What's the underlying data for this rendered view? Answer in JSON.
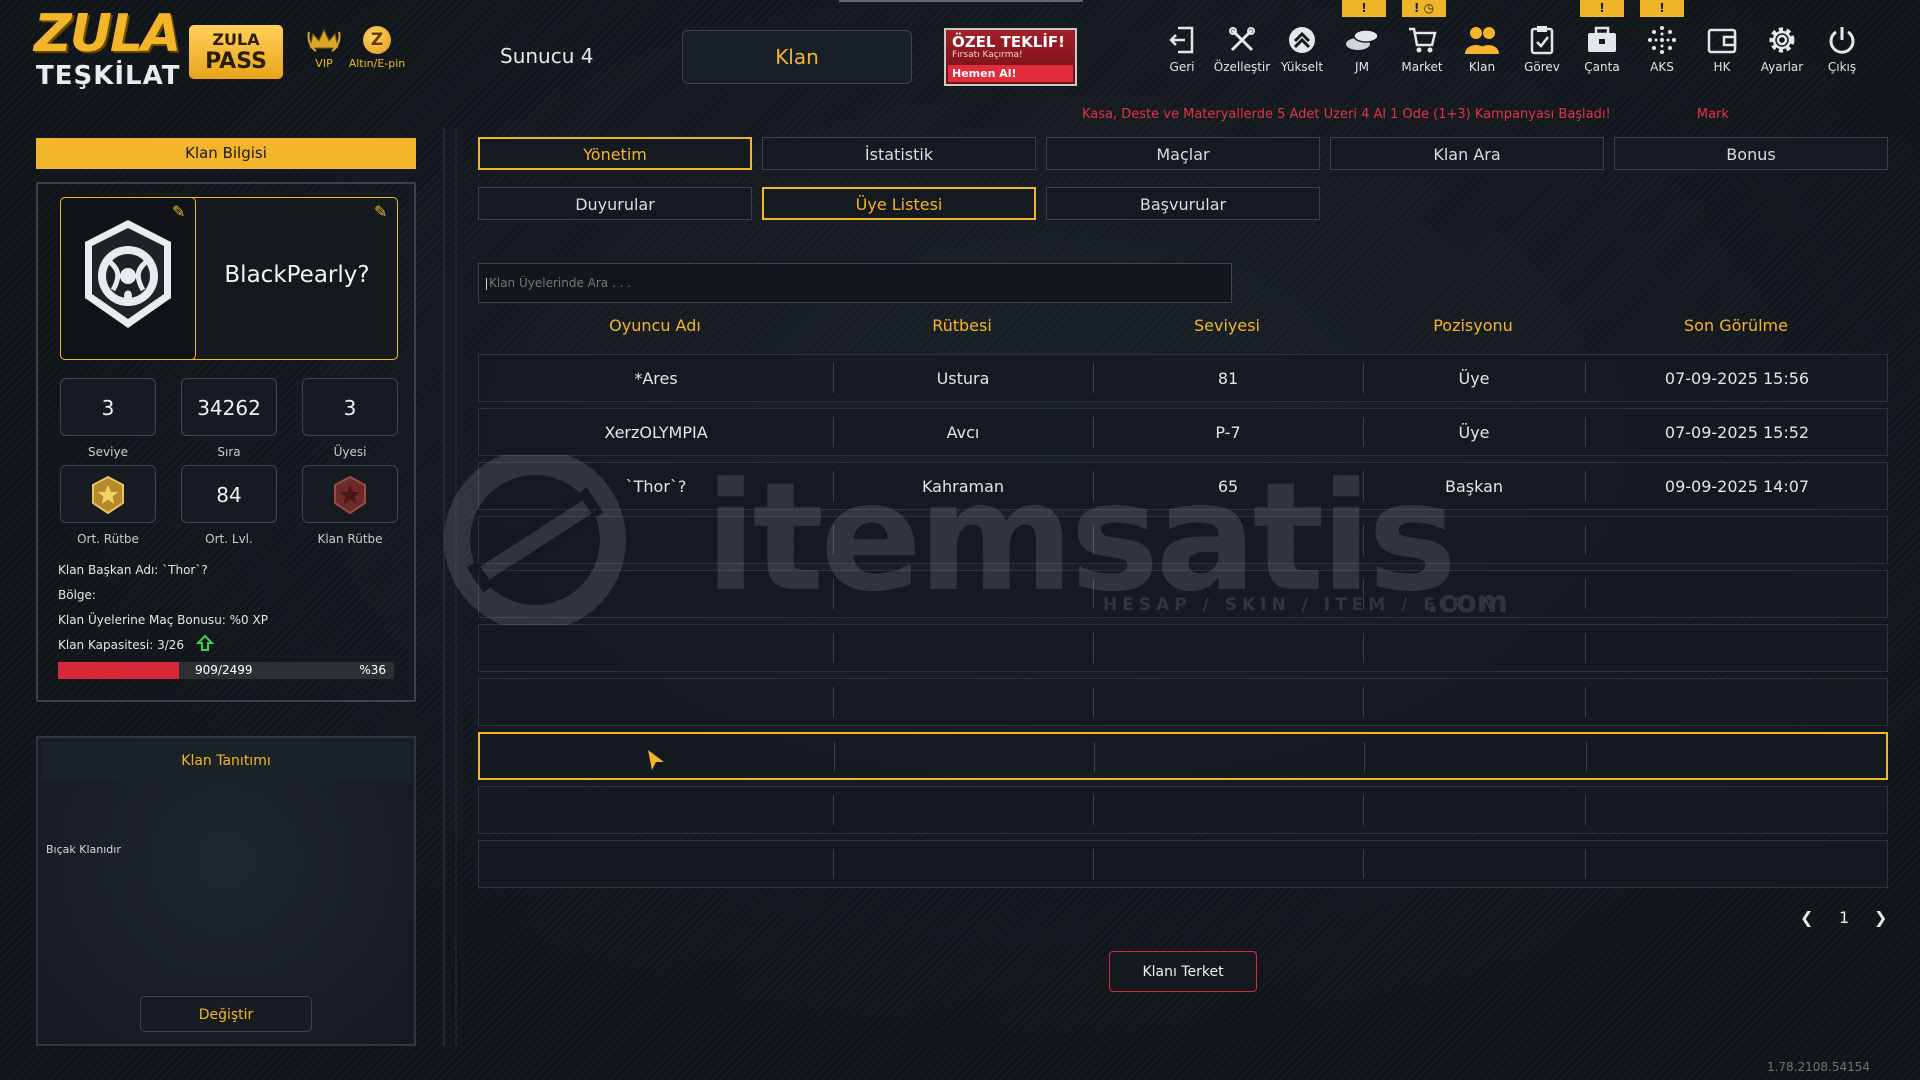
{
  "header": {
    "logo_top": "ZULA",
    "logo_bottom": "TEŞKİLAT",
    "pass_top": "ZULA",
    "pass_bottom": "PASS",
    "vip_label": "VIP",
    "gold_label": "Altın/E-pin",
    "server": "Sunucu 4",
    "section_button": "Klan",
    "offer_title": "ÖZEL TEKLİF!",
    "offer_sub": "Fırsatı Kaçırma!",
    "offer_cta": "Hemen Al!",
    "ticker": "Kasa, Deste ve Materyallerde 5 Adet Üzeri 4 Al 1 Öde (1+3) Kampanyası Başladı!",
    "ticker_next": "Mark"
  },
  "nav": [
    {
      "label": "Geri",
      "icon": "back-icon"
    },
    {
      "label": "Özelleştir",
      "icon": "customize-icon"
    },
    {
      "label": "Yükselt",
      "icon": "upgrade-icon"
    },
    {
      "label": "JM",
      "icon": "coins-icon"
    },
    {
      "label": "Market",
      "icon": "cart-icon"
    },
    {
      "label": "Klan",
      "icon": "clan-icon"
    },
    {
      "label": "Görev",
      "icon": "task-icon"
    },
    {
      "label": "Çanta",
      "icon": "bag-icon"
    },
    {
      "label": "AKS",
      "icon": "aks-icon"
    },
    {
      "label": "HK",
      "icon": "wallet-icon"
    },
    {
      "label": "Ayarlar",
      "icon": "gear-icon"
    },
    {
      "label": "Çıkış",
      "icon": "power-icon"
    }
  ],
  "clan": {
    "panel_title": "Klan Bilgisi",
    "name": "BlackPearly?",
    "stats": [
      {
        "value": "3",
        "label": "Seviye"
      },
      {
        "value": "34262",
        "label": "Sıra"
      },
      {
        "value": "3",
        "label": "Üyesi"
      }
    ],
    "badges": [
      {
        "label": "Ort. Rütbe"
      },
      {
        "value": "84",
        "label": "Ort. Lvl."
      },
      {
        "label": "Klan Rütbe"
      }
    ],
    "leader_line": "Klan Başkan Adı: `Thor`?",
    "region_line": "Bölge:",
    "bonus_line": "Klan Üyelerine Maç Bonusu: %0 XP",
    "capacity_line": "Klan Kapasitesi: 3/26",
    "xp_text": "909/2499",
    "xp_pct_text": "%36",
    "xp_fraction": 0.36,
    "intro_title": "Klan Tanıtımı",
    "intro_text": "Bıçak Klanıdır",
    "change_button": "Değiştir"
  },
  "tabs_row1": [
    "Yönetim",
    "İstatistik",
    "Maçlar",
    "Klan Ara",
    "Bonus"
  ],
  "tabs_row2": [
    "Duyurular",
    "Üye Listesi",
    "Başvurular"
  ],
  "search_placeholder": "Klan Üyelerinde Ara . . .",
  "table": {
    "headers": [
      "Oyuncu Adı",
      "Rütbesi",
      "Seviyesi",
      "Pozisyonu",
      "Son Görülme"
    ],
    "rows": [
      [
        "*Ares",
        "Ustura",
        "81",
        "Üye",
        "07-09-2025 15:56"
      ],
      [
        "XerzOLYMPIA",
        "Avcı",
        "P-7",
        "Üye",
        "07-09-2025 15:52"
      ],
      [
        "`Thor`?",
        "Kahraman",
        "65",
        "Başkan",
        "09-09-2025 14:07"
      ],
      [
        "",
        "",
        "",
        "",
        ""
      ],
      [
        "",
        "",
        "",
        "",
        ""
      ],
      [
        "",
        "",
        "",
        "",
        ""
      ],
      [
        "",
        "",
        "",
        "",
        ""
      ],
      [
        "",
        "",
        "",
        "",
        ""
      ],
      [
        "",
        "",
        "",
        "",
        ""
      ],
      [
        "",
        "",
        "",
        "",
        ""
      ]
    ]
  },
  "pager": {
    "page": "1"
  },
  "leave_button": "Klanı Terket",
  "version": "1.78.2108.54154",
  "watermark": {
    "brand": "itemsatis",
    "tagline": "HESAP / SKIN / ITEM / E-PIN",
    "suffix": ".com"
  },
  "colors": {
    "accent": "#f3b62a",
    "danger": "#d9283b",
    "ticker": "#e23344",
    "bg": "#12171c"
  }
}
